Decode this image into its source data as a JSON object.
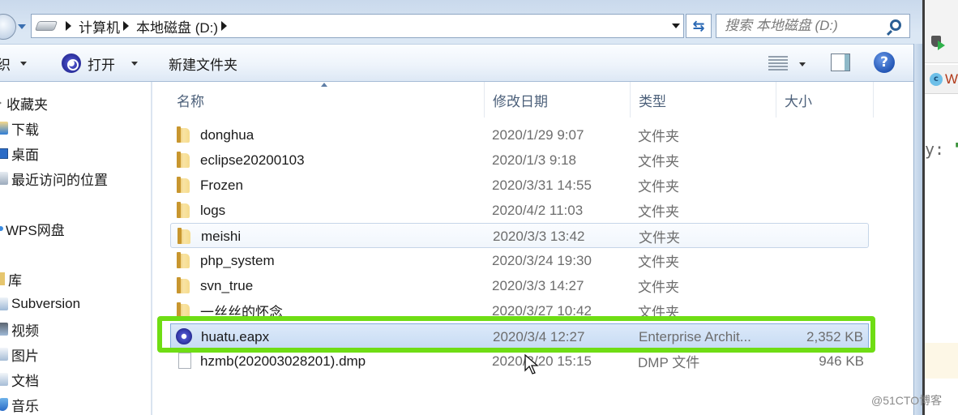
{
  "address_bar": {
    "breadcrumbs": [
      "计算机",
      "本地磁盘 (D:)"
    ],
    "search_placeholder": "搜索 本地磁盘 (D:)"
  },
  "toolbar": {
    "organize_label": "织",
    "open_label": "打开",
    "new_folder_label": "新建文件夹"
  },
  "nav_pane": {
    "items": [
      {
        "label": "收藏夹",
        "icon": "star-icon"
      },
      {
        "label": "下载",
        "icon": "download-folder-icon"
      },
      {
        "label": "桌面",
        "icon": "desktop-icon"
      },
      {
        "label": "最近访问的位置",
        "icon": "recent-places-icon"
      },
      {
        "label": "WPS网盘",
        "icon": "wps-cloud-icon"
      },
      {
        "label": "库",
        "icon": "library-icon"
      },
      {
        "label": "Subversion",
        "icon": "subversion-icon"
      },
      {
        "label": "视频",
        "icon": "video-library-icon"
      },
      {
        "label": "图片",
        "icon": "pictures-library-icon"
      },
      {
        "label": "文档",
        "icon": "documents-library-icon"
      },
      {
        "label": "音乐",
        "icon": "music-library-icon"
      }
    ]
  },
  "file_list": {
    "columns": [
      "名称",
      "修改日期",
      "类型",
      "大小"
    ],
    "rows": [
      {
        "name": "donghua",
        "date": "2020/1/29 9:07",
        "type": "文件夹",
        "size": "",
        "icon": "folder-icon",
        "state": "normal"
      },
      {
        "name": "eclipse20200103",
        "date": "2020/1/3 9:18",
        "type": "文件夹",
        "size": "",
        "icon": "folder-icon",
        "state": "normal"
      },
      {
        "name": "Frozen",
        "date": "2020/3/31 14:55",
        "type": "文件夹",
        "size": "",
        "icon": "folder-icon",
        "state": "normal"
      },
      {
        "name": "logs",
        "date": "2020/4/2 11:03",
        "type": "文件夹",
        "size": "",
        "icon": "folder-icon",
        "state": "normal"
      },
      {
        "name": "meishi",
        "date": "2020/3/3 13:42",
        "type": "文件夹",
        "size": "",
        "icon": "folder-icon",
        "state": "hover"
      },
      {
        "name": "php_system",
        "date": "2020/3/24 19:30",
        "type": "文件夹",
        "size": "",
        "icon": "folder-icon",
        "state": "normal"
      },
      {
        "name": "svn_true",
        "date": "2020/3/3 14:27",
        "type": "文件夹",
        "size": "",
        "icon": "folder-icon",
        "state": "normal"
      },
      {
        "name": "一丝丝的怀念",
        "date": "2020/3/27 10:42",
        "type": "文件夹",
        "size": "",
        "icon": "folder-icon",
        "state": "normal"
      },
      {
        "name": "huatu.eapx",
        "date": "2020/3/4 12:27",
        "type": "Enterprise Archit...",
        "size": "2,352 KB",
        "icon": "enterprise-architect-file-icon",
        "state": "selected"
      },
      {
        "name": "hzmb(202003028201).dmp",
        "date": "2020/3/20 15:15",
        "type": "DMP 文件",
        "size": "946 KB",
        "icon": "generic-file-icon",
        "state": "normal"
      }
    ]
  },
  "highlight_color": "#6fdd14",
  "right_window": {
    "tab_label": "W",
    "code_text": "y: ",
    "code_string": "\"-"
  },
  "watermark": "@51CTO博客"
}
